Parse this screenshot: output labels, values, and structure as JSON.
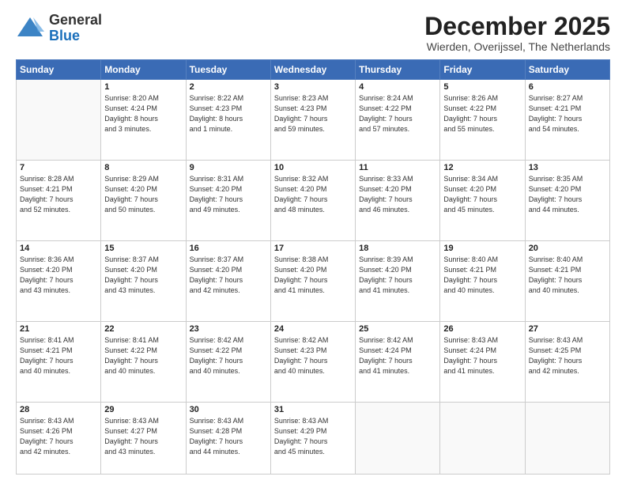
{
  "logo": {
    "text_general": "General",
    "text_blue": "Blue"
  },
  "header": {
    "month": "December 2025",
    "location": "Wierden, Overijssel, The Netherlands"
  },
  "weekdays": [
    "Sunday",
    "Monday",
    "Tuesday",
    "Wednesday",
    "Thursday",
    "Friday",
    "Saturday"
  ],
  "rows": [
    [
      {
        "num": "",
        "info": ""
      },
      {
        "num": "1",
        "info": "Sunrise: 8:20 AM\nSunset: 4:24 PM\nDaylight: 8 hours\nand 3 minutes."
      },
      {
        "num": "2",
        "info": "Sunrise: 8:22 AM\nSunset: 4:23 PM\nDaylight: 8 hours\nand 1 minute."
      },
      {
        "num": "3",
        "info": "Sunrise: 8:23 AM\nSunset: 4:23 PM\nDaylight: 7 hours\nand 59 minutes."
      },
      {
        "num": "4",
        "info": "Sunrise: 8:24 AM\nSunset: 4:22 PM\nDaylight: 7 hours\nand 57 minutes."
      },
      {
        "num": "5",
        "info": "Sunrise: 8:26 AM\nSunset: 4:22 PM\nDaylight: 7 hours\nand 55 minutes."
      },
      {
        "num": "6",
        "info": "Sunrise: 8:27 AM\nSunset: 4:21 PM\nDaylight: 7 hours\nand 54 minutes."
      }
    ],
    [
      {
        "num": "7",
        "info": "Sunrise: 8:28 AM\nSunset: 4:21 PM\nDaylight: 7 hours\nand 52 minutes."
      },
      {
        "num": "8",
        "info": "Sunrise: 8:29 AM\nSunset: 4:20 PM\nDaylight: 7 hours\nand 50 minutes."
      },
      {
        "num": "9",
        "info": "Sunrise: 8:31 AM\nSunset: 4:20 PM\nDaylight: 7 hours\nand 49 minutes."
      },
      {
        "num": "10",
        "info": "Sunrise: 8:32 AM\nSunset: 4:20 PM\nDaylight: 7 hours\nand 48 minutes."
      },
      {
        "num": "11",
        "info": "Sunrise: 8:33 AM\nSunset: 4:20 PM\nDaylight: 7 hours\nand 46 minutes."
      },
      {
        "num": "12",
        "info": "Sunrise: 8:34 AM\nSunset: 4:20 PM\nDaylight: 7 hours\nand 45 minutes."
      },
      {
        "num": "13",
        "info": "Sunrise: 8:35 AM\nSunset: 4:20 PM\nDaylight: 7 hours\nand 44 minutes."
      }
    ],
    [
      {
        "num": "14",
        "info": "Sunrise: 8:36 AM\nSunset: 4:20 PM\nDaylight: 7 hours\nand 43 minutes."
      },
      {
        "num": "15",
        "info": "Sunrise: 8:37 AM\nSunset: 4:20 PM\nDaylight: 7 hours\nand 43 minutes."
      },
      {
        "num": "16",
        "info": "Sunrise: 8:37 AM\nSunset: 4:20 PM\nDaylight: 7 hours\nand 42 minutes."
      },
      {
        "num": "17",
        "info": "Sunrise: 8:38 AM\nSunset: 4:20 PM\nDaylight: 7 hours\nand 41 minutes."
      },
      {
        "num": "18",
        "info": "Sunrise: 8:39 AM\nSunset: 4:20 PM\nDaylight: 7 hours\nand 41 minutes."
      },
      {
        "num": "19",
        "info": "Sunrise: 8:40 AM\nSunset: 4:21 PM\nDaylight: 7 hours\nand 40 minutes."
      },
      {
        "num": "20",
        "info": "Sunrise: 8:40 AM\nSunset: 4:21 PM\nDaylight: 7 hours\nand 40 minutes."
      }
    ],
    [
      {
        "num": "21",
        "info": "Sunrise: 8:41 AM\nSunset: 4:21 PM\nDaylight: 7 hours\nand 40 minutes."
      },
      {
        "num": "22",
        "info": "Sunrise: 8:41 AM\nSunset: 4:22 PM\nDaylight: 7 hours\nand 40 minutes."
      },
      {
        "num": "23",
        "info": "Sunrise: 8:42 AM\nSunset: 4:22 PM\nDaylight: 7 hours\nand 40 minutes."
      },
      {
        "num": "24",
        "info": "Sunrise: 8:42 AM\nSunset: 4:23 PM\nDaylight: 7 hours\nand 40 minutes."
      },
      {
        "num": "25",
        "info": "Sunrise: 8:42 AM\nSunset: 4:24 PM\nDaylight: 7 hours\nand 41 minutes."
      },
      {
        "num": "26",
        "info": "Sunrise: 8:43 AM\nSunset: 4:24 PM\nDaylight: 7 hours\nand 41 minutes."
      },
      {
        "num": "27",
        "info": "Sunrise: 8:43 AM\nSunset: 4:25 PM\nDaylight: 7 hours\nand 42 minutes."
      }
    ],
    [
      {
        "num": "28",
        "info": "Sunrise: 8:43 AM\nSunset: 4:26 PM\nDaylight: 7 hours\nand 42 minutes."
      },
      {
        "num": "29",
        "info": "Sunrise: 8:43 AM\nSunset: 4:27 PM\nDaylight: 7 hours\nand 43 minutes."
      },
      {
        "num": "30",
        "info": "Sunrise: 8:43 AM\nSunset: 4:28 PM\nDaylight: 7 hours\nand 44 minutes."
      },
      {
        "num": "31",
        "info": "Sunrise: 8:43 AM\nSunset: 4:29 PM\nDaylight: 7 hours\nand 45 minutes."
      },
      {
        "num": "",
        "info": ""
      },
      {
        "num": "",
        "info": ""
      },
      {
        "num": "",
        "info": ""
      }
    ]
  ]
}
